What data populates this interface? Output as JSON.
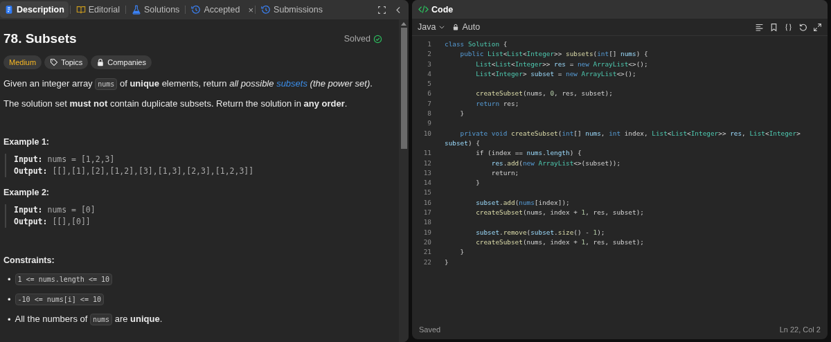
{
  "description_panel": {
    "tabs": [
      {
        "label": "Description",
        "selected": true
      },
      {
        "label": "Editorial",
        "selected": false
      },
      {
        "label": "Solutions",
        "selected": false
      },
      {
        "label": "Accepted",
        "selected": false,
        "close": "×"
      },
      {
        "label": "Submissions",
        "selected": false
      }
    ],
    "title": "78. Subsets",
    "status": "Solved",
    "tags": [
      {
        "label": "Medium",
        "kind": "difficulty"
      },
      {
        "label": "Topics",
        "kind": "topics"
      },
      {
        "label": "Companies",
        "kind": "companies"
      }
    ],
    "paragraphs": [
      [
        {
          "kind": "text",
          "t": "Given an integer array "
        },
        {
          "kind": "code",
          "t": "nums"
        },
        {
          "kind": "text",
          "t": " of **unique** elements, return *all possible* "
        },
        {
          "kind": "link",
          "t": "subsets"
        },
        {
          "kind": "text",
          "t": " *(the power set)*."
        }
      ],
      [
        {
          "kind": "text",
          "t": "The solution set **must not** contain duplicate subsets. Return the solution in **any order**."
        }
      ]
    ],
    "examples": [
      {
        "heading": "Example 1:",
        "lines": [
          {
            "label": "Input:",
            "value": "nums = [1,2,3]"
          },
          {
            "label": "Output:",
            "value": "[[],[1],[2],[1,2],[3],[1,3],[2,3],[1,2,3]]"
          }
        ]
      },
      {
        "heading": "Example 2:",
        "lines": [
          {
            "label": "Input:",
            "value": "nums = [0]"
          },
          {
            "label": "Output:",
            "value": "[[],[0]]"
          }
        ]
      }
    ],
    "constraints_heading": "Constraints:",
    "constraints": [
      {
        "bullet": "•",
        "segments": [
          {
            "kind": "code",
            "t": "1 <= nums.length <= 10"
          }
        ]
      },
      {
        "bullet": "•",
        "segments": [
          {
            "kind": "code",
            "t": "-10 <= nums[i] <= 10"
          }
        ]
      },
      {
        "bullet": "•",
        "segments": [
          {
            "kind": "text",
            "t": "All the numbers of "
          },
          {
            "kind": "code",
            "t": "nums"
          },
          {
            "kind": "text",
            "t": " are **unique**."
          }
        ]
      }
    ]
  },
  "editor": {
    "title": "Code",
    "language": "Java",
    "mode": "Auto",
    "lines": [
      {
        "number": "1",
        "text": "class Solution {"
      },
      {
        "number": "2",
        "text": "    public List<List<Integer>> subsets(int[] nums) {"
      },
      {
        "number": "3",
        "text": "        List<List<Integer>> res = new ArrayList<>();"
      },
      {
        "number": "4",
        "text": "        List<Integer> subset = new ArrayList<>();"
      },
      {
        "number": "5"
      },
      {
        "number": "6",
        "text": "        createSubset(nums, 0, res, subset);"
      },
      {
        "number": "7",
        "text": "        return res;"
      },
      {
        "number": "8",
        "text": "    }"
      },
      {
        "number": "9"
      },
      {
        "number": "10",
        "text": "    private void createSubset(int[] nums, int index, List<List<Integer>> res, List<Integer> subset) {"
      },
      {
        "number": "11",
        "text": "        if (index == nums.length) {"
      },
      {
        "number": "12",
        "text": "            res.add(new ArrayList<>(subset));"
      },
      {
        "number": "13",
        "text": "            return;"
      },
      {
        "number": "14",
        "text": "        }"
      },
      {
        "number": "15"
      },
      {
        "number": "16",
        "text": "        subset.add(nums[index]);"
      },
      {
        "number": "17",
        "text": "        createSubset(nums, index + 1, res, subset);"
      },
      {
        "number": "18"
      },
      {
        "number": "19",
        "text": "        subset.remove(subset.size() - 1);"
      },
      {
        "number": "20",
        "text": "        createSubset(nums, index + 1, res, subset);"
      },
      {
        "number": "21",
        "text": "    }"
      },
      {
        "number": "22",
        "text": "}"
      }
    ],
    "status_left": "Saved",
    "status_right": "Ln 22, Col 2"
  }
}
